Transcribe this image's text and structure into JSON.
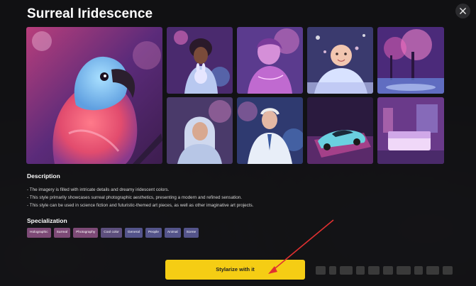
{
  "modal": {
    "title": "Surreal Iridescence",
    "description_heading": "Description",
    "description_items": [
      "- The imagery is filled with intricate details and dreamy iridescent colors.",
      "- This style primarily showcases surreal photographic aesthetics, presenting a modern and refined sensation.",
      "- This style can be used in science fiction and futuristic-themed art pieces, as well as other imaginative art projects."
    ],
    "specialization_heading": "Specialization",
    "tags": [
      "Holographic",
      "Surreal",
      "Photography",
      "Cool color",
      "General",
      "People",
      "Animal",
      "Scene"
    ],
    "cta_label": "Stylarize with it"
  },
  "icons": {
    "close": "close-icon"
  },
  "colors": {
    "cta": "#f5cd14",
    "background": "#141416"
  }
}
